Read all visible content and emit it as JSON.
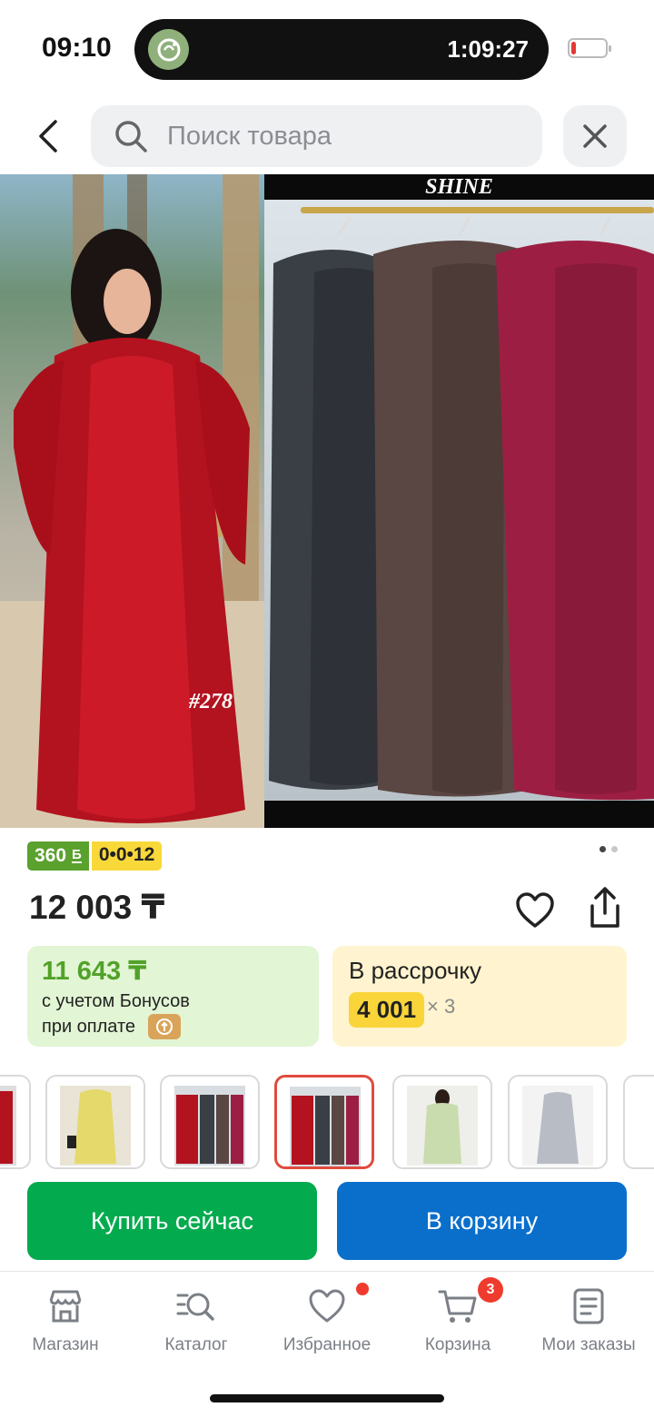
{
  "status_bar": {
    "clock": "09:10",
    "island_timer": "1:09:27",
    "battery_level_percent": 15
  },
  "search": {
    "placeholder": "Поиск товара"
  },
  "gallery": {
    "brand_label": "SHINE",
    "tag_label": "#278",
    "image_count": 2,
    "active_image_index": 0
  },
  "badges": {
    "bonus": "360",
    "bonus_mark": "Б",
    "credit": "0•0•12"
  },
  "product": {
    "price": "12 003 ₸"
  },
  "bonus_card": {
    "price": "11 643 ₸",
    "line1": "с учетом Бонусов",
    "line2": "при оплате"
  },
  "installment_card": {
    "title": "В рассрочку",
    "amount": "4 001",
    "multiplier": "× 3"
  },
  "thumbnails": {
    "items": [
      {
        "name": "thumb-red-partial"
      },
      {
        "name": "thumb-yellow-set"
      },
      {
        "name": "thumb-red-rack"
      },
      {
        "name": "thumb-red-rack-selected"
      },
      {
        "name": "thumb-green-set"
      },
      {
        "name": "thumb-grey-dress"
      },
      {
        "name": "thumb-partial"
      }
    ],
    "selected_index": 3
  },
  "actions": {
    "buy_now": "Купить сейчас",
    "add_to_cart": "В корзину"
  },
  "tabbar": {
    "items": [
      {
        "label": "Магазин",
        "icon": "store-icon"
      },
      {
        "label": "Каталог",
        "icon": "catalog-search-icon"
      },
      {
        "label": "Избранное",
        "icon": "heart-icon"
      },
      {
        "label": "Корзина",
        "icon": "cart-icon"
      },
      {
        "label": "Мои заказы",
        "icon": "orders-icon"
      }
    ],
    "cart_badge": "3"
  },
  "colors": {
    "accent_green": "#04ab4e",
    "accent_blue": "#0a6fcb",
    "bonus_green": "#5aa12e",
    "credit_yellow": "#f9d83a",
    "alert_red": "#ef3b2d"
  }
}
